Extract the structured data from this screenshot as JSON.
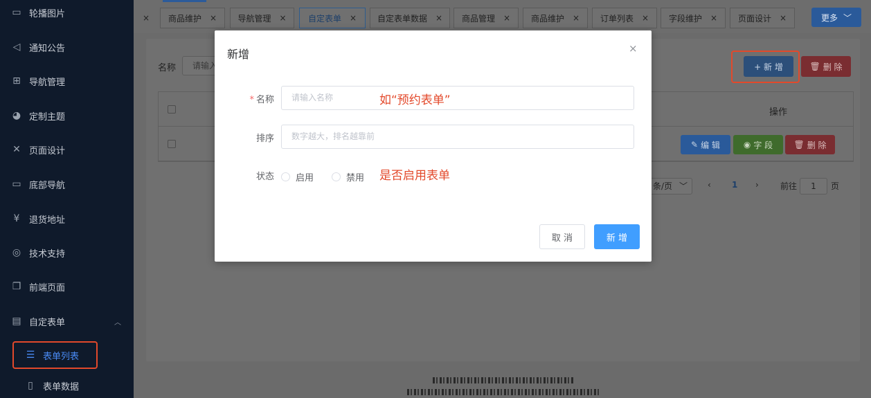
{
  "sidebar": {
    "items": [
      {
        "label": "轮播图片",
        "icon": "image-icon"
      },
      {
        "label": "通知公告",
        "icon": "speaker-icon"
      },
      {
        "label": "导航管理",
        "icon": "grid-icon"
      },
      {
        "label": "定制主题",
        "icon": "palette-icon"
      },
      {
        "label": "页面设计",
        "icon": "tools-icon"
      },
      {
        "label": "底部导航",
        "icon": "monitor-icon"
      },
      {
        "label": "退货地址",
        "icon": "yen-icon"
      },
      {
        "label": "技术支持",
        "icon": "support-icon"
      },
      {
        "label": "前端页面",
        "icon": "window-icon"
      },
      {
        "label": "自定表单",
        "icon": "clipboard-icon"
      }
    ],
    "children": [
      {
        "label": "表单列表",
        "icon": "list-icon"
      },
      {
        "label": "表单数据",
        "icon": "document-icon"
      }
    ]
  },
  "tabs": [
    {
      "label": "商品维护"
    },
    {
      "label": "导航管理"
    },
    {
      "label": "自定表单"
    },
    {
      "label": "自定表单数据"
    },
    {
      "label": "商品管理"
    },
    {
      "label": "商品维护"
    },
    {
      "label": "订单列表"
    },
    {
      "label": "字段维护"
    },
    {
      "label": "页面设计"
    }
  ],
  "tab_close_glyph": "×",
  "more_label": "更多",
  "search": {
    "label": "名称",
    "placeholder": "请输入"
  },
  "toolbar": {
    "add_label": "+ 新 增",
    "delete_label": "删 除"
  },
  "table": {
    "op_header": "操作",
    "edit_label": "编 辑",
    "field_label": "字 段",
    "delete_label": "删 除"
  },
  "pager": {
    "page_size": "条/页",
    "current_page": "1",
    "goto_label": "前往",
    "goto_value": "1",
    "page_suffix": "页"
  },
  "modal": {
    "title": "新增",
    "close": "×",
    "fields": {
      "name_label": "名称",
      "name_placeholder": "请输入名称",
      "sort_label": "排序",
      "sort_placeholder": "数字越大，排名越靠前",
      "status_label": "状态",
      "status_options": [
        "启用",
        "禁用"
      ]
    },
    "cancel_label": "取 消",
    "ok_label": "新 增"
  },
  "annotations": {
    "name_hint": "如“预约表单”",
    "status_hint": "是否启用表单"
  },
  "colors": {
    "primary": "#409eff",
    "annotation": "#e3492b",
    "sidebar_bg": "#0f1a2b",
    "danger": "#f56c6c"
  }
}
